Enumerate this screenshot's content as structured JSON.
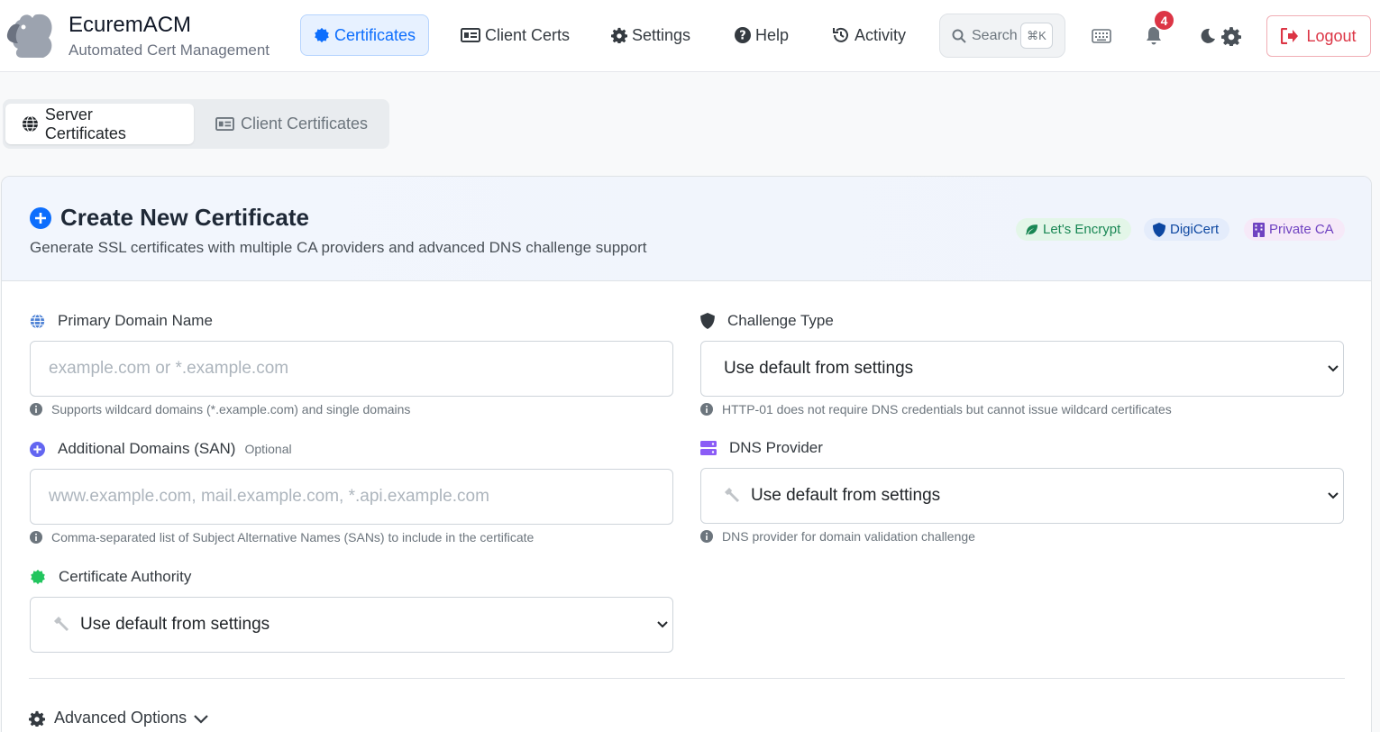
{
  "app": {
    "name": "EcuremACM",
    "subtitle": "Automated Cert Management"
  },
  "nav": {
    "items": [
      {
        "label": "Certificates",
        "icon": "certificate-icon",
        "active": true
      },
      {
        "label": "Client Certs",
        "icon": "id-card-icon"
      },
      {
        "label": "Settings",
        "icon": "gear-icon"
      },
      {
        "label": "Help",
        "icon": "question-circle-icon"
      },
      {
        "label": "Activity",
        "icon": "history-icon"
      }
    ],
    "search_label": "Search",
    "search_shortcut": "⌘K",
    "notification_count": "4",
    "logout_label": "Logout"
  },
  "tabs": [
    {
      "label": "Server Certificates",
      "active": true
    },
    {
      "label": "Client Certificates",
      "active": false
    }
  ],
  "card": {
    "title": "Create New Certificate",
    "description": "Generate SSL certificates with multiple CA providers and advanced DNS challenge support",
    "providers": [
      "Let's Encrypt",
      "DigiCert",
      "Private CA"
    ]
  },
  "form": {
    "primary_domain": {
      "label": "Primary Domain Name",
      "placeholder": "example.com or *.example.com",
      "help": "Supports wildcard domains (*.example.com) and single domains"
    },
    "san": {
      "label": "Additional Domains (SAN)",
      "optional": "Optional",
      "placeholder": "www.example.com, mail.example.com, *.api.example.com",
      "help": "Comma-separated list of Subject Alternative Names (SANs) to include in the certificate"
    },
    "ca": {
      "label": "Certificate Authority",
      "value": "Use default from settings"
    },
    "challenge": {
      "label": "Challenge Type",
      "value": "Use default from settings",
      "help": "HTTP-01 does not require DNS credentials but cannot issue wildcard certificates"
    },
    "dns": {
      "label": "DNS Provider",
      "value": "Use default from settings",
      "help": "DNS provider for domain validation challenge"
    },
    "advanced_label": "Advanced Options"
  },
  "colors": {
    "primary": "#0d6efd",
    "danger": "#dc3545",
    "success": "#198754",
    "purple": "#8b5cf6"
  }
}
